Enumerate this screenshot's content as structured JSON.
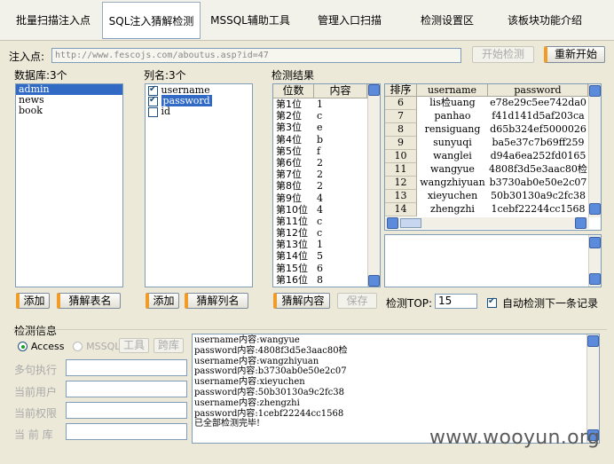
{
  "tabs": [
    {
      "label": "批量扫描注入点"
    },
    {
      "label": "SQL注入猜解检测"
    },
    {
      "label": "MSSQL辅助工具"
    },
    {
      "label": "管理入口扫描"
    },
    {
      "label": "检测设置区"
    },
    {
      "label": "该板块功能介绍"
    }
  ],
  "inject": {
    "label": "注入点:",
    "url": "http://www.fescojs.com/aboutus.asp?id=47",
    "start_label": "开始检测",
    "restart_label": "重新开始"
  },
  "databases": {
    "label": "数据库:3个",
    "items": [
      "admin",
      "news",
      "book"
    ],
    "selected": 0,
    "add_label": "添加",
    "guess_label": "猜解表名"
  },
  "columns": {
    "label": "列名:3个",
    "items": [
      {
        "name": "username",
        "checked": true
      },
      {
        "name": "password",
        "checked": true
      },
      {
        "name": "id",
        "checked": false
      }
    ],
    "selected": 1,
    "add_label": "添加",
    "guess_label": "猜解列名"
  },
  "results": {
    "label": "检测结果",
    "pos_header": "位数",
    "content_header": "内容",
    "positions": [
      {
        "pos": "第1位",
        "val": "1"
      },
      {
        "pos": "第2位",
        "val": "c"
      },
      {
        "pos": "第3位",
        "val": "e"
      },
      {
        "pos": "第4位",
        "val": "b"
      },
      {
        "pos": "第5位",
        "val": "f"
      },
      {
        "pos": "第6位",
        "val": "2"
      },
      {
        "pos": "第7位",
        "val": "2"
      },
      {
        "pos": "第8位",
        "val": "2"
      },
      {
        "pos": "第9位",
        "val": "4"
      },
      {
        "pos": "第10位",
        "val": "4"
      },
      {
        "pos": "第11位",
        "val": "c"
      },
      {
        "pos": "第12位",
        "val": "c"
      },
      {
        "pos": "第13位",
        "val": "1"
      },
      {
        "pos": "第14位",
        "val": "5"
      },
      {
        "pos": "第15位",
        "val": "6"
      },
      {
        "pos": "第16位",
        "val": "8"
      }
    ],
    "guess_content_label": "猜解内容",
    "save_label": "保存",
    "table_headers": {
      "rank": "排序",
      "username": "username",
      "password": "password"
    },
    "rows": [
      {
        "rank": "6",
        "username": "lis检uang",
        "password": "e78e29c5ee742da0"
      },
      {
        "rank": "7",
        "username": "panhao",
        "password": "f41d141d5af203ca"
      },
      {
        "rank": "8",
        "username": "rensiguang",
        "password": "d65b324ef5000026"
      },
      {
        "rank": "9",
        "username": "sunyuqi",
        "password": "ba5e37c7b69ff259"
      },
      {
        "rank": "10",
        "username": "wanglei",
        "password": "d94a6ea252fd0165"
      },
      {
        "rank": "11",
        "username": "wangyue",
        "password": "4808f3d5e3aac80检"
      },
      {
        "rank": "12",
        "username": "wangzhiyuan",
        "password": "b3730ab0e50e2c07"
      },
      {
        "rank": "13",
        "username": "xieyuchen",
        "password": "50b30130a9c2fc38"
      },
      {
        "rank": "14",
        "username": "zhengzhi",
        "password": "1cebf22244cc1568"
      }
    ],
    "top_label": "检测TOP:",
    "top_value": "15",
    "auto_label": "自动检测下一条记录",
    "auto_checked": true
  },
  "info": {
    "label": "检测信息",
    "access_label": "Access",
    "mssql_label": "MSSQL",
    "tool_label": "工具",
    "cross_label": "跨库",
    "rows": [
      {
        "label": "多句执行"
      },
      {
        "label": "当前用户"
      },
      {
        "label": "当前权限"
      },
      {
        "label": "当 前 库"
      }
    ],
    "log": [
      "username内容:wangyue",
      "password内容:4808f3d5e3aac80检",
      "username内容:wangzhiyuan",
      "password内容:b3730ab0e50e2c07",
      "username内容:xieyuchen",
      "password内容:50b30130a9c2fc38",
      "username内容:zhengzhi",
      "password内容:1cebf22244cc1568",
      "已全部检测完毕!"
    ]
  },
  "watermark": "www.wooyun.org",
  "colors": {
    "accent": "#f19c28",
    "selection": "#316ac5",
    "scroll": "#5c8bdc"
  }
}
